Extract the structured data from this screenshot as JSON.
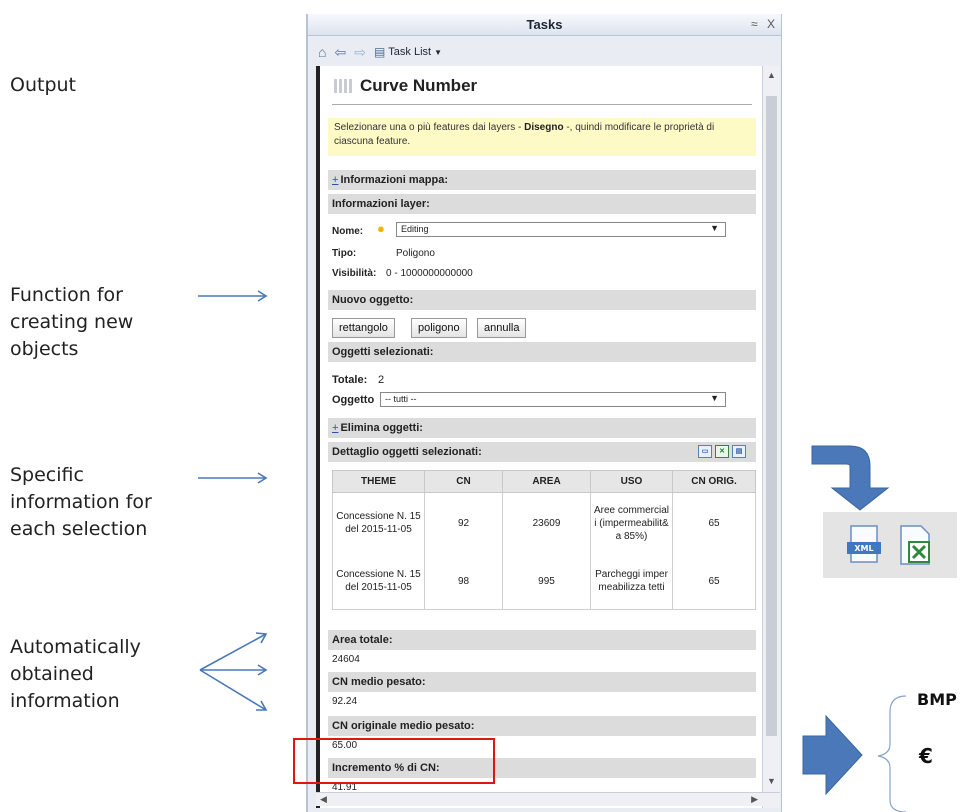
{
  "slide": {
    "labels": {
      "output": "Output",
      "new_objects": "Function for\ncreating new\nobjects",
      "specific_info": "Specific\ninformation for\neach selection",
      "auto_info": "Automatically\nobtained\ninformation"
    },
    "bmp": "BMP",
    "currency": "€",
    "colors": {
      "arrow": "#4a78b8",
      "highlight_box": "#e01515"
    }
  },
  "window": {
    "title": "Tasks",
    "controls": [
      "≈",
      "X"
    ],
    "toolbar": {
      "task_list_label": "Task List",
      "icons": [
        "home-icon",
        "back-arrow-icon",
        "forward-arrow-icon",
        "list-icon"
      ]
    }
  },
  "panel": {
    "title": "Curve Number",
    "notice_pre": "Selezionare una o più features dai layers - ",
    "notice_bold": "Disegno",
    "notice_post": " -, quindi modificare le proprietà di ciascuna feature.",
    "sections": {
      "map_info": "Informazioni mappa:",
      "layer_info": "Informazioni layer:",
      "new_object": "Nuovo oggetto:",
      "selected": "Oggetti selezionati:",
      "delete": "Elimina oggetti:",
      "detail": "Dettaglio oggetti selezionati:",
      "total_area": "Area totale:",
      "cn_weighted": "CN medio pesato:",
      "cn_orig_weighted": "CN originale medio pesato:",
      "cn_increase": "Incremento % di CN:"
    },
    "plus": "+",
    "layer": {
      "name_label": "Nome:",
      "name_value": "Editing",
      "type_label": "Tipo:",
      "type_value": "Poligono",
      "visibility_label": "Visibilità:",
      "visibility_value": "0 - 1000000000000"
    },
    "buttons": {
      "rectangle": "rettangolo",
      "polygon": "poligono",
      "cancel": "annulla"
    },
    "selection": {
      "total_label": "Totale:",
      "total_value": "2",
      "object_label": "Oggetto",
      "object_value": "-- tutti --"
    },
    "table": {
      "headers": [
        "THEME",
        "CN",
        "AREA",
        "USO",
        "CN ORIG."
      ],
      "rows": [
        {
          "theme": "Concessione N. 15 del 2015-11-05",
          "cn": "92",
          "area": "23609",
          "uso": "Aree commerciali (impermeabilit&a 85%)",
          "cn_orig": "65"
        },
        {
          "theme": "Concessione N. 15 del 2015-11-05",
          "cn": "98",
          "area": "995",
          "uso": "Parcheggi impermeabilizza tetti",
          "cn_orig": "65"
        }
      ]
    },
    "values": {
      "total_area": "24604",
      "cn_weighted": "92.24",
      "cn_orig_weighted": "65.00",
      "cn_increase": "41.91"
    }
  }
}
